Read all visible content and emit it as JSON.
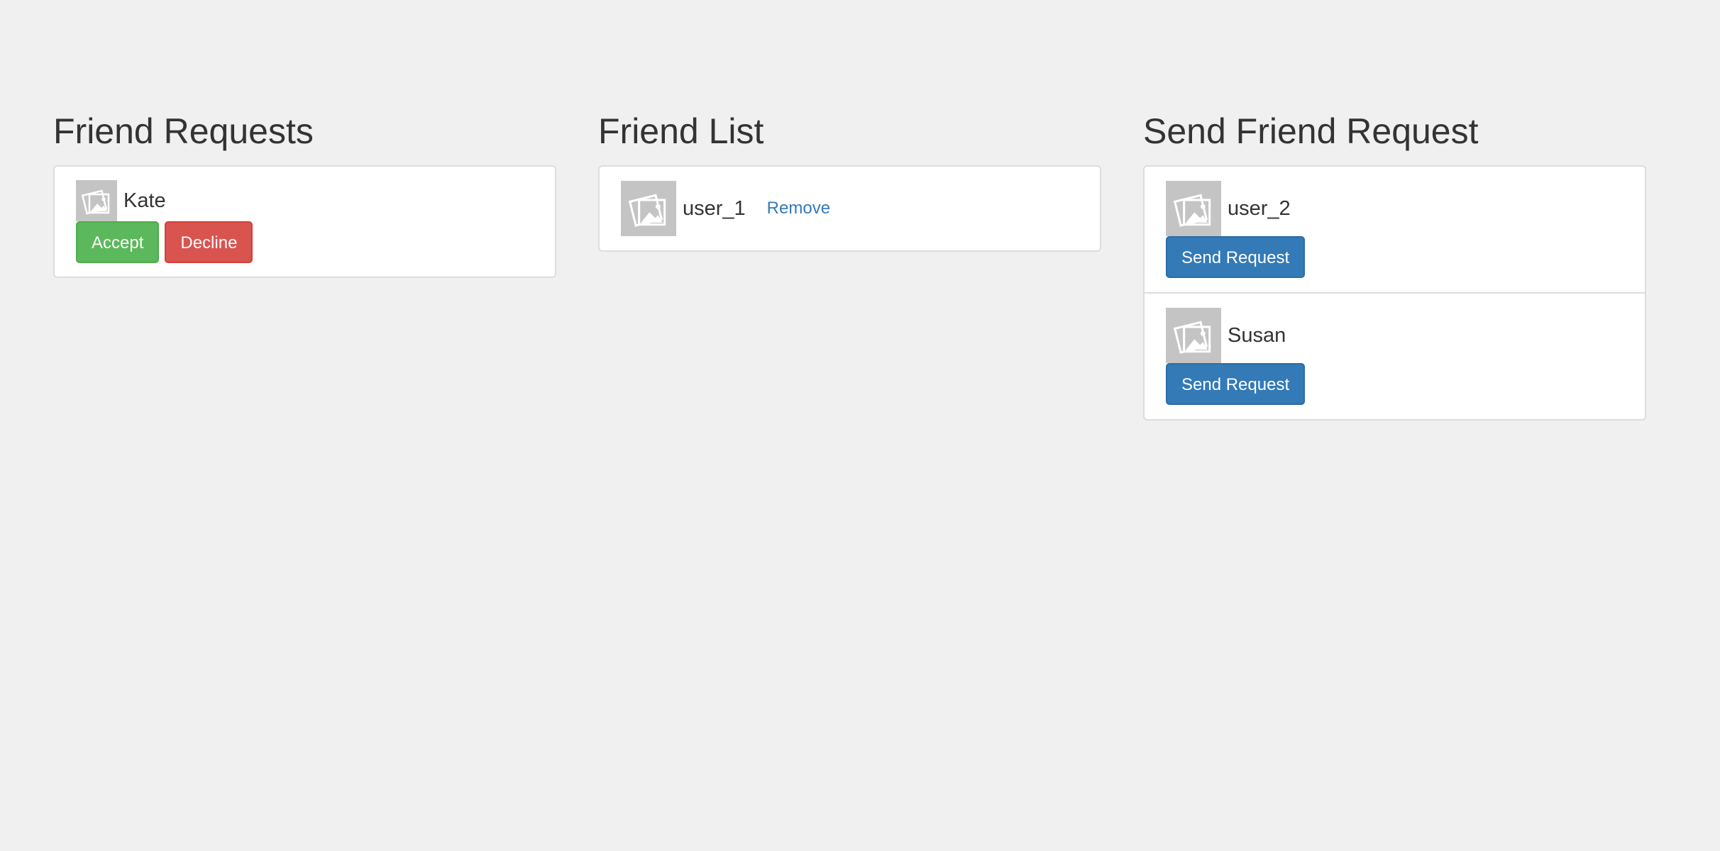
{
  "friend_requests": {
    "title": "Friend Requests",
    "items": [
      {
        "name": "Kate",
        "accept_label": "Accept",
        "decline_label": "Decline"
      }
    ]
  },
  "friend_list": {
    "title": "Friend List",
    "items": [
      {
        "name": "user_1",
        "remove_label": "Remove"
      }
    ]
  },
  "send_friend_request": {
    "title": "Send Friend Request",
    "items": [
      {
        "name": "user_2",
        "button_label": "Send Request"
      },
      {
        "name": "Susan",
        "button_label": "Send Request"
      }
    ]
  },
  "colors": {
    "background": "#f0f0f0",
    "accept": "#5cb85c",
    "decline": "#d9534f",
    "primary": "#337ab7",
    "avatar_placeholder": "#c4c4c4"
  },
  "icons": {
    "avatar": "image-placeholder-icon"
  }
}
